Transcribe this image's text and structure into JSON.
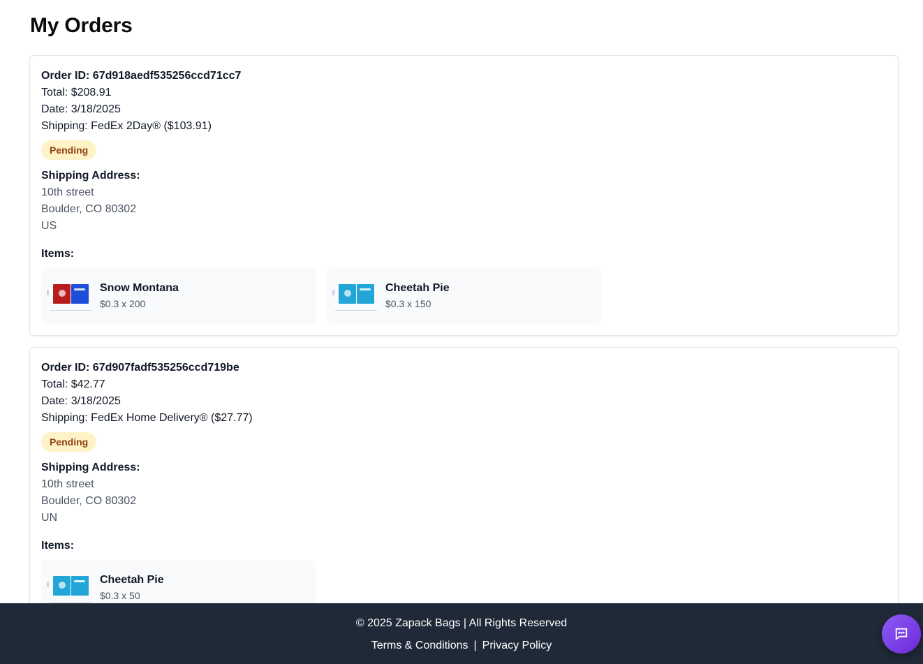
{
  "page_title": "My Orders",
  "colors": {
    "badge_bg": "#fef3c7",
    "badge_text": "#92400e",
    "footer_bg": "#1f2937",
    "chat_button": "#7c3aed"
  },
  "orders": [
    {
      "id_line": "Order ID: 67d918aedf535256ccd71cc7",
      "total_line": "Total: $208.91",
      "date_line": "Date: 3/18/2025",
      "shipping_line": "Shipping: FedEx 2Day® ($103.91)",
      "status": "Pending",
      "address_label": "Shipping Address:",
      "address": [
        "10th street",
        "Boulder, CO 80302",
        "US"
      ],
      "items_label": "Items:",
      "items": [
        {
          "name": "Snow Montana",
          "price": "$0.3 x 200",
          "thumb_left": "#b91c1c",
          "thumb_right": "#1d4ed8"
        },
        {
          "name": "Cheetah Pie",
          "price": "$0.3 x 150",
          "thumb_left": "#22a6d8",
          "thumb_right": "#22a6d8"
        }
      ]
    },
    {
      "id_line": "Order ID: 67d907fadf535256ccd719be",
      "total_line": "Total: $42.77",
      "date_line": "Date: 3/18/2025",
      "shipping_line": "Shipping: FedEx Home Delivery® ($27.77)",
      "status": "Pending",
      "address_label": "Shipping Address:",
      "address": [
        "10th street",
        "Boulder, CO 80302",
        "UN"
      ],
      "items_label": "Items:",
      "items": [
        {
          "name": "Cheetah Pie",
          "price": "$0.3 x 50",
          "thumb_left": "#22a6d8",
          "thumb_right": "#22a6d8"
        }
      ]
    }
  ],
  "footer": {
    "copyright": "© 2025 Zapack Bags | All Rights Reserved",
    "terms": "Terms & Conditions",
    "separator": "|",
    "privacy": "Privacy Policy"
  },
  "chat_button": {
    "icon": "chat-icon"
  }
}
